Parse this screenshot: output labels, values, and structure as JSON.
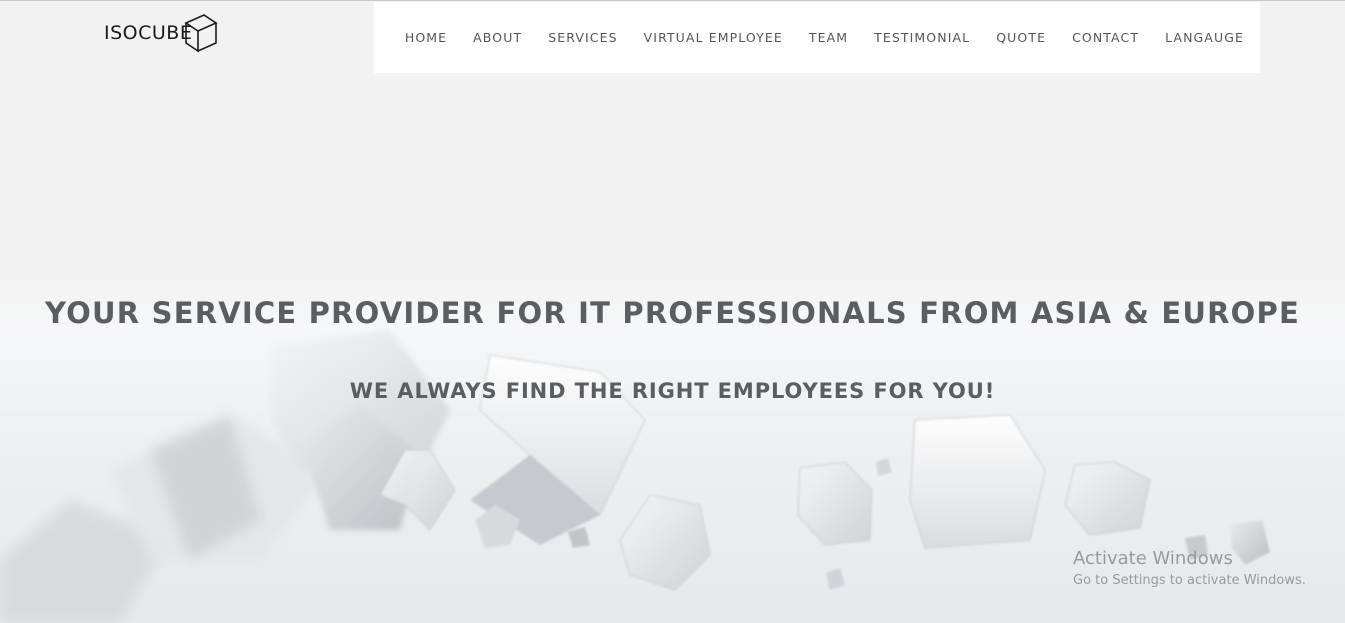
{
  "brand": {
    "logo_text": "ISOCUBE",
    "logo_icon": "cube-icon"
  },
  "nav": {
    "items": [
      {
        "label": "HOME"
      },
      {
        "label": "ABOUT"
      },
      {
        "label": "SERVICES"
      },
      {
        "label": "VIRTUAL EMPLOYEE"
      },
      {
        "label": "TEAM"
      },
      {
        "label": "TESTIMONIAL"
      },
      {
        "label": "QUOTE"
      },
      {
        "label": "CONTACT"
      },
      {
        "label": "LANGAUGE"
      }
    ]
  },
  "hero": {
    "headline": "YOUR SERVICE PROVIDER FOR IT PROFESSIONALS FROM ASIA & EUROPE",
    "subheadline": "WE ALWAYS FIND THE RIGHT EMPLOYEES FOR YOU!",
    "background": "glass cubes on light gray floor"
  },
  "os_watermark": {
    "title": "Activate Windows",
    "subtitle": "Go to Settings to activate Windows."
  },
  "colors": {
    "page_bg": "#f2f2f2",
    "nav_bg": "#ffffff",
    "nav_text": "#555555",
    "heading_text": "#5b5d61",
    "watermark_text": "#9a9a9a"
  }
}
